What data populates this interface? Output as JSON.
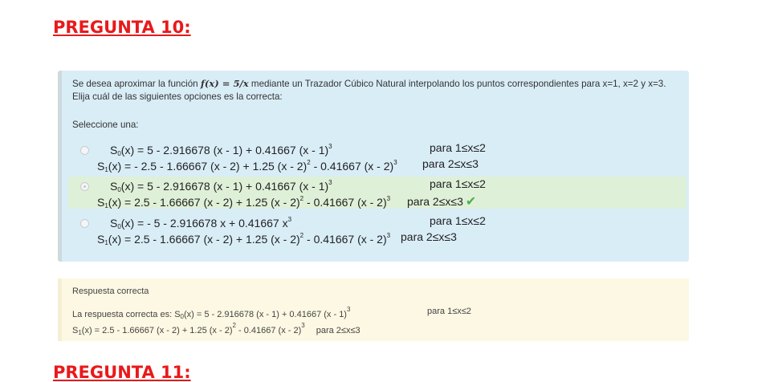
{
  "headings": {
    "current": "PREGUNTA 10:",
    "next": "PREGUNTA 11:"
  },
  "question": {
    "text_before": "Se desea aproximar la función ",
    "formula": "f(x) = 5/x",
    "text_after": " mediante un Trazador Cúbico Natural interpolando los puntos correspondientes para x=1, x=2 y x=3. Elija cuál de las siguientes opciones es la correcta:",
    "prompt": "Seleccione una:"
  },
  "options": [
    {
      "line1": "S0(x) = 5 - 2.916678 (x - 1) + 0.41667 (x - 1)^3",
      "cond1": "para 1≤x≤2",
      "line2": "S1(x) = - 2.5 - 1.66667 (x - 2) + 1.25 (x - 2)^2 - 0.41667 (x - 2)^3",
      "cond2": "para 2≤x≤3",
      "selected": false,
      "correct": false
    },
    {
      "line1": "S0(x) = 5 - 2.916678 (x - 1) + 0.41667 (x - 1)^3",
      "cond1": "para 1≤x≤2",
      "line2": "S1(x) = 2.5 - 1.66667 (x - 2) + 1.25 (x - 2)^2 - 0.41667 (x - 2)^3",
      "cond2": "para 2≤x≤3",
      "selected": true,
      "correct": true
    },
    {
      "line1": "S0(x) = - 5 - 2.916678 x + 0.41667 x^3",
      "cond1": "para 1≤x≤2",
      "line2": "S1(x) = 2.5 - 1.66667 (x - 2) + 1.25 (x - 2)^2 - 0.41667 (x - 2)^3",
      "cond2": "para 2≤x≤3",
      "selected": false,
      "correct": false
    }
  ],
  "feedback": {
    "status": "Respuesta correcta",
    "prefix": "La respuesta correcta es: ",
    "line1": "S0(x) = 5 - 2.916678 (x - 1) + 0.41667 (x - 1)^3",
    "cond1": "para 1≤x≤2",
    "line2": "S1(x) = 2.5 - 1.66667 (x - 2) + 1.25 (x - 2)^2 - 0.41667 (x - 2)^3",
    "cond2": "para 2≤x≤3"
  },
  "colors": {
    "heading": "#e8191b",
    "question_bg": "#d9edf7",
    "correct_bg": "#dff0d8",
    "feedback_bg": "#fcf8e3",
    "check": "#4cae4c"
  },
  "icons": {
    "correct": "check-icon"
  }
}
